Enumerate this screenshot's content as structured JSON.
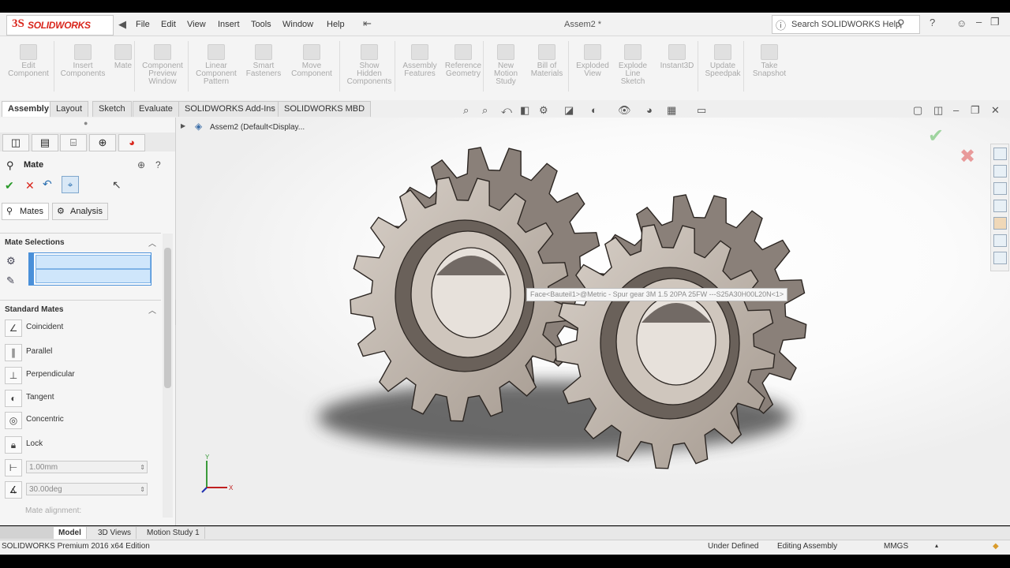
{
  "app": {
    "logo_ds": "3S",
    "logo_text": "SOLIDWORKS",
    "doc_title": "Assem2 *",
    "search_placeholder": "Search SOLIDWORKS Help",
    "menu": [
      "File",
      "Edit",
      "View",
      "Insert",
      "Tools",
      "Window",
      "Help"
    ]
  },
  "command_manager": [
    {
      "label": "Edit\nComponent"
    },
    {
      "label": "Insert\nComponents"
    },
    {
      "label": "Mate"
    },
    {
      "label": "Component\nPreview\nWindow"
    },
    {
      "label": "Linear\nComponent\nPattern"
    },
    {
      "label": "Smart\nFasteners"
    },
    {
      "label": "Move\nComponent"
    },
    {
      "label": "Show\nHidden\nComponents"
    },
    {
      "label": "Assembly\nFeatures"
    },
    {
      "label": "Reference\nGeometry"
    },
    {
      "label": "New\nMotion\nStudy"
    },
    {
      "label": "Bill of\nMaterials"
    },
    {
      "label": "Exploded\nView"
    },
    {
      "label": "Explode\nLine\nSketch"
    },
    {
      "label": "Instant3D"
    },
    {
      "label": "Update\nSpeedpak"
    },
    {
      "label": "Take\nSnapshot"
    }
  ],
  "tabs": [
    "Assembly",
    "Layout",
    "Sketch",
    "Evaluate",
    "SOLIDWORKS Add-Ins",
    "SOLIDWORKS MBD"
  ],
  "tree_root": "Assem2  (Default<Display...",
  "property_manager": {
    "title": "Mate",
    "subtabs": [
      "Mates",
      "Analysis"
    ],
    "mate_selections_label": "Mate Selections",
    "standard_mates_label": "Standard Mates",
    "standard_mates": [
      "Coincident",
      "Parallel",
      "Perpendicular",
      "Tangent",
      "Concentric",
      "Lock"
    ],
    "distance_value": "1.00mm",
    "angle_value": "30.00deg",
    "mate_alignment_label": "Mate alignment:"
  },
  "tooltip": "Face<Bauteil1>@Metric - Spur gear 3M 1.5 20PA 25FW ---S25A30H00L20N<1>",
  "bottom_tabs": [
    "Model",
    "3D Views",
    "Motion Study 1"
  ],
  "status": {
    "edition": "SOLIDWORKS Premium 2016 x64 Edition",
    "definition": "Under Defined",
    "mode": "Editing Assembly",
    "units": "MMGS"
  },
  "colors": {
    "accent_red": "#d9261c",
    "selection_blue": "#4a90d9",
    "gear_face": "#c9bdb3",
    "gear_edge": "#2c2622"
  }
}
